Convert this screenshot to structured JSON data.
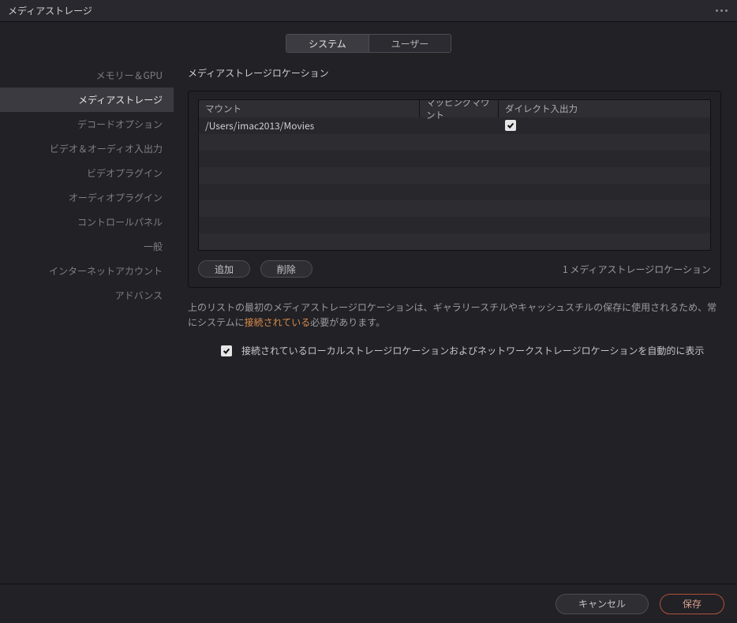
{
  "titlebar": {
    "title": "メディアストレージ"
  },
  "tabs": {
    "system": "システム",
    "user": "ユーザー",
    "active": "system"
  },
  "sidebar": {
    "items": [
      {
        "label": "メモリー＆GPU",
        "active": false
      },
      {
        "label": "メディアストレージ",
        "active": true
      },
      {
        "label": "デコードオプション",
        "active": false
      },
      {
        "label": "ビデオ＆オーディオ入出力",
        "active": false
      },
      {
        "label": "ビデオプラグイン",
        "active": false
      },
      {
        "label": "オーディオプラグイン",
        "active": false
      },
      {
        "label": "コントロールパネル",
        "active": false
      },
      {
        "label": "一般",
        "active": false
      },
      {
        "label": "インターネットアカウント",
        "active": false
      },
      {
        "label": "アドバンス",
        "active": false
      }
    ]
  },
  "section": {
    "title": "メディアストレージロケーション"
  },
  "table": {
    "headers": {
      "mount": "マウント",
      "mapping": "マッピングマウント",
      "direct_io": "ダイレクト入出力"
    },
    "rows": [
      {
        "mount": "/Users/imac2013/Movies",
        "mapping": "",
        "direct_io": true
      }
    ],
    "empty_row_count": 7
  },
  "actions": {
    "add": "追加",
    "remove": "削除",
    "count_text": "1 メディアストレージロケーション"
  },
  "help": {
    "pre": "上のリストの最初のメディアストレージロケーションは、ギャラリースチルやキャッシュスチルの保存に使用されるため、常にシステムに",
    "link": "接続されている",
    "post": "必要があります。"
  },
  "auto_display": {
    "checked": true,
    "label": "接続されているローカルストレージロケーションおよびネットワークストレージロケーションを自動的に表示"
  },
  "footer": {
    "cancel": "キャンセル",
    "save": "保存"
  }
}
